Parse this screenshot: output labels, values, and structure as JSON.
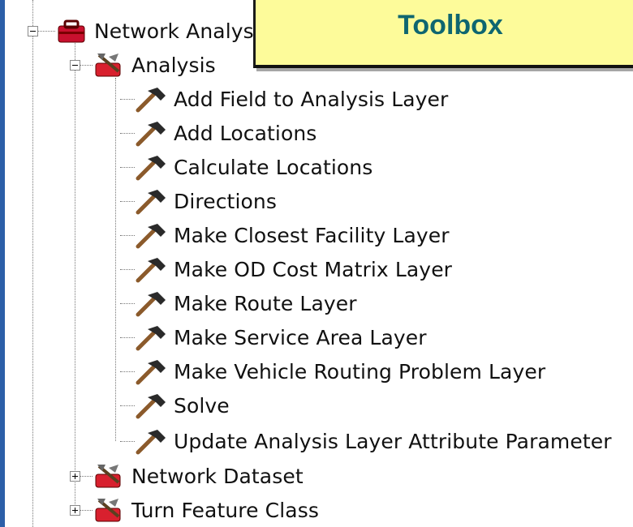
{
  "callout": {
    "title": "Toolbox"
  },
  "tree": {
    "root": {
      "label": "Network Analys"
    },
    "analysis": {
      "label": "Analysis"
    },
    "tools": [
      {
        "label": "Add Field to Analysis Layer"
      },
      {
        "label": "Add Locations"
      },
      {
        "label": "Calculate Locations"
      },
      {
        "label": "Directions"
      },
      {
        "label": "Make Closest Facility Layer"
      },
      {
        "label": "Make OD Cost Matrix Layer"
      },
      {
        "label": "Make Route Layer"
      },
      {
        "label": "Make Service Area Layer"
      },
      {
        "label": "Make Vehicle Routing Problem Layer"
      },
      {
        "label": "Solve"
      },
      {
        "label": "Update Analysis Layer Attribute Parameter"
      }
    ],
    "network_dataset": {
      "label": "Network Dataset"
    },
    "turn_feature_class": {
      "label": "Turn Feature Class"
    }
  }
}
